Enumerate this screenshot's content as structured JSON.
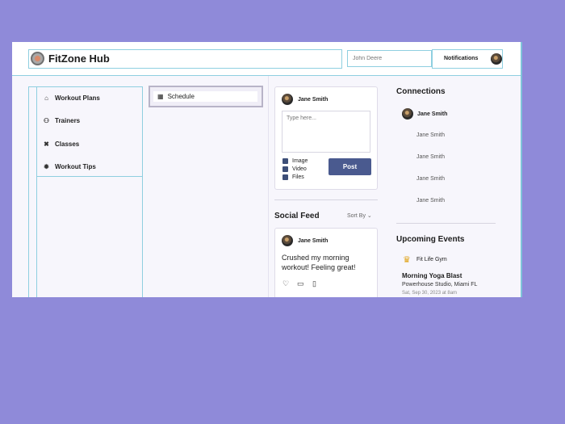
{
  "header": {
    "brand": "FitZone Hub",
    "search_value": "John Deere",
    "notifications_label": "Notifications"
  },
  "nav": {
    "items": [
      {
        "label": "Workout Plans",
        "icon": "home-icon"
      },
      {
        "label": "Trainers",
        "icon": "users-icon"
      },
      {
        "label": "Classes",
        "icon": "dumbbell-icon"
      },
      {
        "label": "Workout Tips",
        "icon": "gear-icon"
      }
    ]
  },
  "schedule": {
    "label": "Schedule",
    "icon": "calendar-icon"
  },
  "composer": {
    "user": "Jane Smith",
    "placeholder": "Type here...",
    "attachments": [
      "Image",
      "Video",
      "Files"
    ],
    "post_label": "Post"
  },
  "feed": {
    "title": "Social Feed",
    "sort_label": "Sort By",
    "post": {
      "user": "Jane Smith",
      "text": "Crushed my morning workout! Feeling great!"
    }
  },
  "connections": {
    "title": "Connections",
    "people": [
      "Jane Smith",
      "Jane Smith",
      "Jane Smith",
      "Jane Smith",
      "Jane Smith"
    ]
  },
  "events": {
    "title": "Upcoming Events",
    "organizer": "Fit Life Gym",
    "event_title": "Morning Yoga Blast",
    "location": "Powerhouse Studio, Miami FL",
    "date": "Sat, Sep 30, 2023 at 8am"
  },
  "colors": {
    "background": "#8f8ad9",
    "accent_border": "#8fcfe0",
    "post_button": "#4a5a8f",
    "event_icon": "#e0a419"
  }
}
